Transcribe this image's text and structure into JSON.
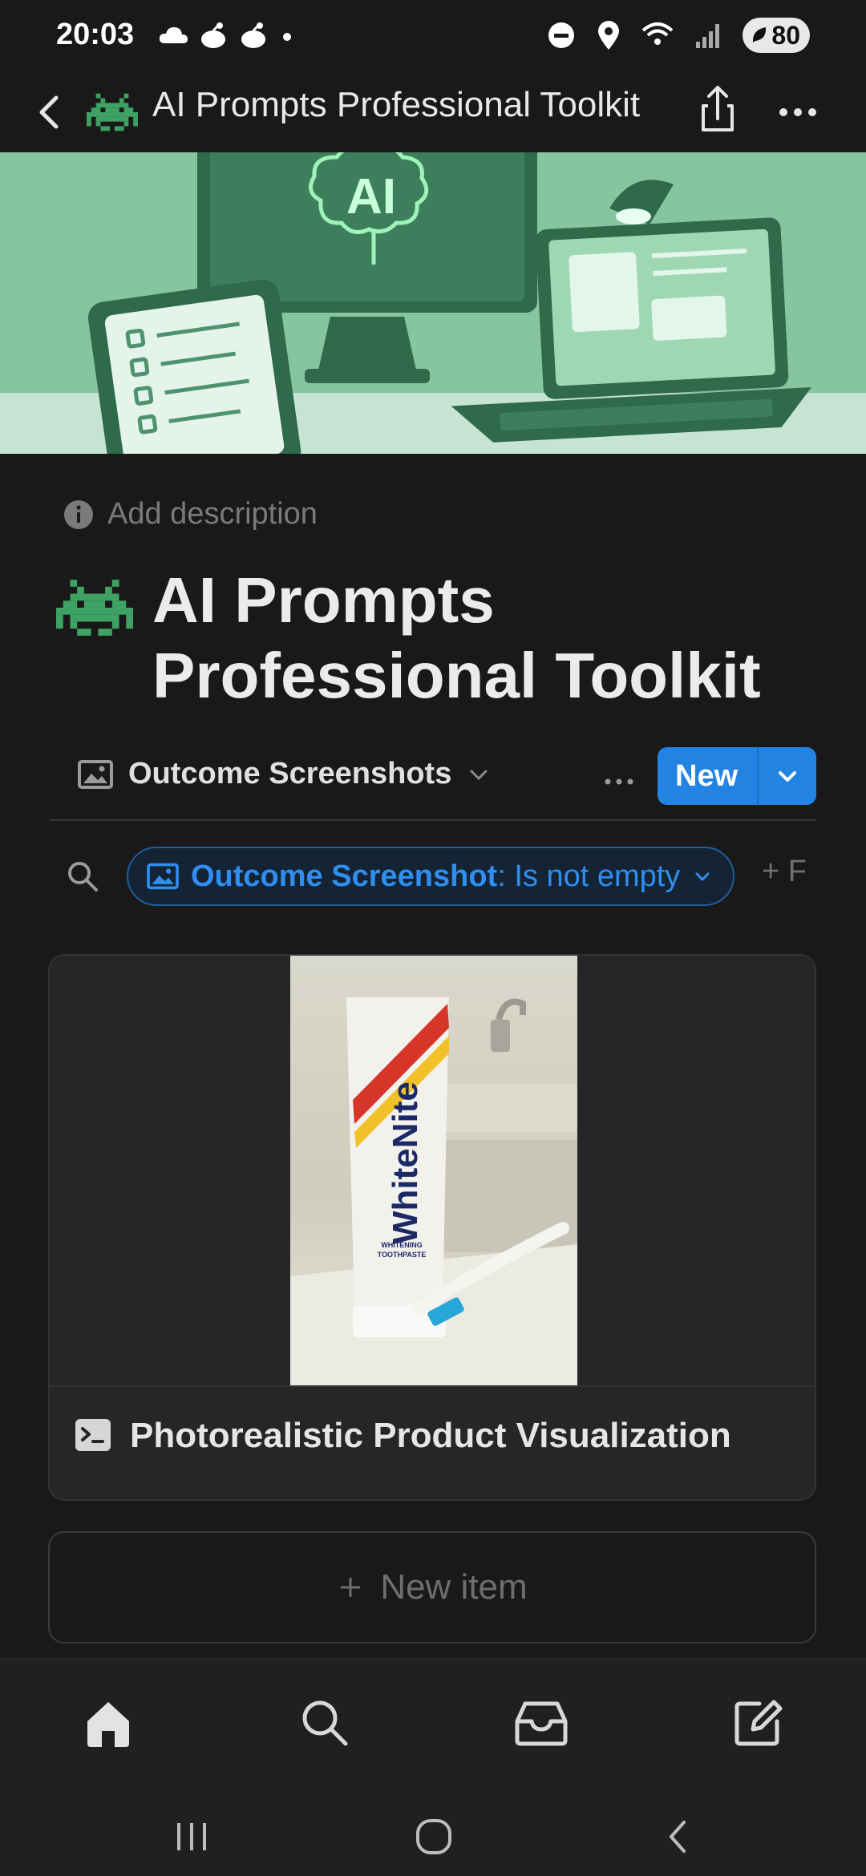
{
  "status_bar": {
    "time": "20:03",
    "battery": "80"
  },
  "nav": {
    "title": "AI Prompts Professional Toolkit",
    "page_icon": "space-invader-icon"
  },
  "cover": {
    "badge_text": "AI"
  },
  "page": {
    "add_description": "Add description",
    "title": "AI Prompts Professional Toolkit"
  },
  "view": {
    "tab_label": "Outcome Screenshots",
    "new_label": "New"
  },
  "filter": {
    "property": "Outcome Screenshot",
    "condition": ": Is not empty",
    "add_label": "+ F"
  },
  "card": {
    "title": "Photorealistic Product Visualization",
    "image_brand": "WhiteNite",
    "image_caption_line1": "WHITENING",
    "image_caption_line2": "TOOTHPASTE"
  },
  "new_item": {
    "label": "New item"
  },
  "colors": {
    "background": "#191919",
    "accent": "#2383e2",
    "filter_text": "#2f8ef0",
    "emoji_green": "#3fa163"
  },
  "tabs": [
    "home-icon",
    "search-icon",
    "inbox-icon",
    "compose-icon"
  ]
}
